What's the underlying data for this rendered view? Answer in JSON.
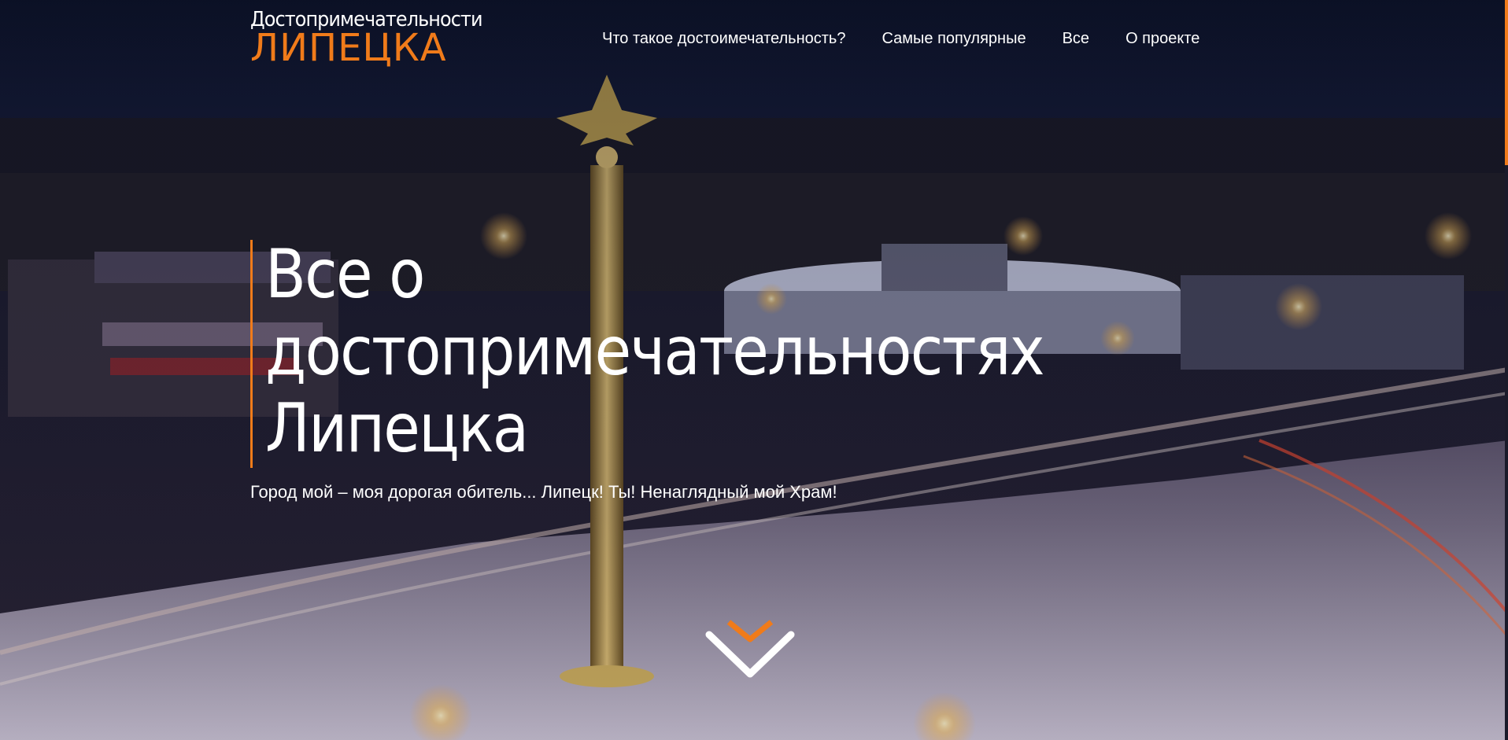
{
  "header": {
    "logo_top": "Достопримечательности",
    "logo_bottom": "ЛИПЕЦКА",
    "nav": [
      {
        "label": "Что такое достоимечательность?"
      },
      {
        "label": "Самые популярные"
      },
      {
        "label": "Все"
      },
      {
        "label": "О проекте"
      }
    ]
  },
  "hero": {
    "title_line1": "Все о",
    "title_line2": "достопримечательностях",
    "title_line3": "Липецка",
    "subtitle": "Город мой – моя дорогая обитель... Липецк! Ты! Ненаглядный мой Храм!",
    "scroll_icon": "chevron-down-icon"
  },
  "colors": {
    "accent": "#f07b1a",
    "text": "#ffffff",
    "sky": "#0b1022"
  },
  "background_icon": "night-city-photo"
}
